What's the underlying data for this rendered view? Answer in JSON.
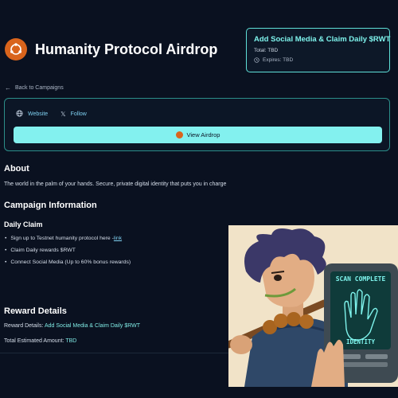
{
  "header": {
    "title": "Humanity Protocol Airdrop",
    "logo_icon": "humanity-logo-icon"
  },
  "promo": {
    "title": "Add Social Media & Claim Daily $RWT",
    "total": "Total: TBD",
    "expires": "Expires: TBD"
  },
  "nav": {
    "back_label": "Back to Campaigns"
  },
  "links": {
    "website": "Website",
    "follow": "Follow",
    "view_airdrop": "View Airdrop"
  },
  "about": {
    "heading": "About",
    "text": "The world in the palm of your hands.  Secure, private digital identity that puts you in charge"
  },
  "campaign": {
    "heading": "Campaign Information",
    "daily_claim": "Daily Claim",
    "items": [
      {
        "text": "Sign up to Testnet humanity protocol here - ",
        "link": "link"
      },
      {
        "text": "Claim Daily rewards $RWT",
        "link": ""
      },
      {
        "text": "Connect Social Media (Up to 60% bonus rewards)",
        "link": ""
      }
    ]
  },
  "reward": {
    "heading": "Reward Details",
    "details_label": "Reward Details:",
    "details_value": "Add Social Media & Claim Daily $RWT",
    "total_label": "Total Estimated Amount:",
    "total_value": "TBD"
  },
  "art": {
    "scan_text": "SCAN COMPLETE",
    "identity_text": "IDENTITY"
  },
  "colors": {
    "accent": "#83f1ef",
    "brand": "#d9641c",
    "background": "#0a1120"
  }
}
